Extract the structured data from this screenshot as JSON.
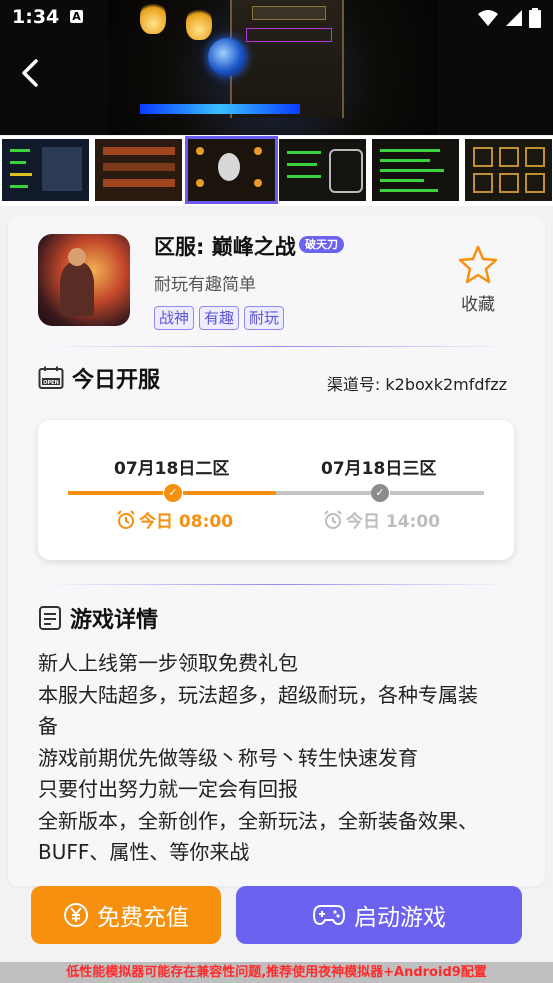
{
  "status_bar": {
    "time": "1:34",
    "notification_icon": "A"
  },
  "hero": {
    "back_icon": "back-arrow-icon"
  },
  "thumbnails": {
    "count": 6,
    "selected_index": 2
  },
  "game": {
    "title": "区服: 巅峰之战",
    "badge": "破天刀",
    "subtitle": "耐玩有趣简单",
    "tags": [
      "战神",
      "有趣",
      "耐玩"
    ],
    "favorite_label": "收藏"
  },
  "today_servers": {
    "title": "今日开服",
    "channel": "渠道号: k2boxk2mfdfzz",
    "servers": [
      {
        "name": "07月18日二区",
        "time": "今日 08:00",
        "active": true
      },
      {
        "name": "07月18日三区",
        "time": "今日 14:00",
        "active": false
      }
    ]
  },
  "details": {
    "title": "游戏详情",
    "lines": [
      "新人上线第一步领取免费礼包",
      "本服大陆超多，玩法超多，超级耐玩，各种专属装",
      "备",
      "游戏前期优先做等级丶称号丶转生快速发育",
      "只要付出努力就一定会有回报",
      "全新版本，全新创作，全新玩法，全新装备效果、",
      "BUFF、属性、等你来战"
    ]
  },
  "actions": {
    "recharge_label": "免费充值",
    "start_label": "启动游戏"
  },
  "notice": "低性能模拟器可能存在兼容性问题,推荐使用夜神模拟器+Android9配置",
  "colors": {
    "accent": "#6b63f0",
    "orange": "#f7900e",
    "notice_red": "#ff2a2a"
  }
}
